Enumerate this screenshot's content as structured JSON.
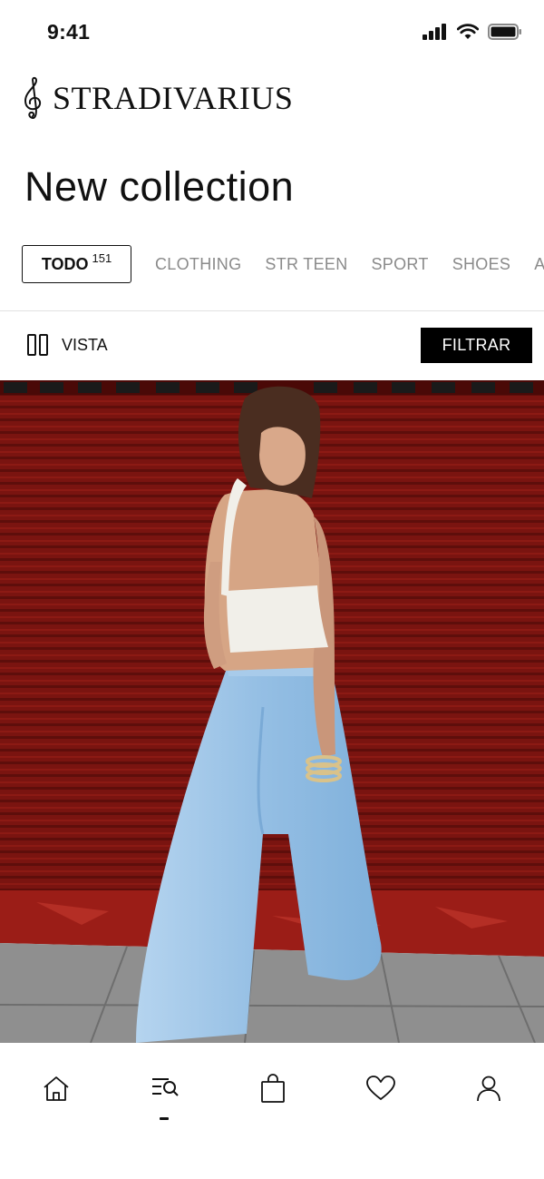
{
  "status_bar": {
    "time": "9:41",
    "icons": [
      "signal-icon",
      "wifi-icon",
      "battery-icon"
    ]
  },
  "brand": {
    "name": "STRADIVARIUS",
    "logo_icon": "treble-clef-icon"
  },
  "page": {
    "title": "New collection"
  },
  "tabs": {
    "active": {
      "label": "TODO",
      "count": "151"
    },
    "items": [
      "CLOTHING",
      "STR TEEN",
      "SPORT",
      "SHOES",
      "ACC"
    ]
  },
  "toolbar": {
    "view_icon": "columns-view-icon",
    "view_label": "VISTA",
    "filter_label": "FILTRAR"
  },
  "product": {
    "image": "model-white-halter-top-blue-wide-pants"
  },
  "bottom_nav": {
    "items": [
      "home-icon",
      "search-menu-icon",
      "bag-icon",
      "heart-icon",
      "profile-icon"
    ],
    "active": "search-menu-icon"
  },
  "colors": {
    "accent": "#000000",
    "text": "#111111",
    "muted": "#8a8a8a",
    "wall": "#7a1410",
    "pants": "#9cc4e6"
  }
}
